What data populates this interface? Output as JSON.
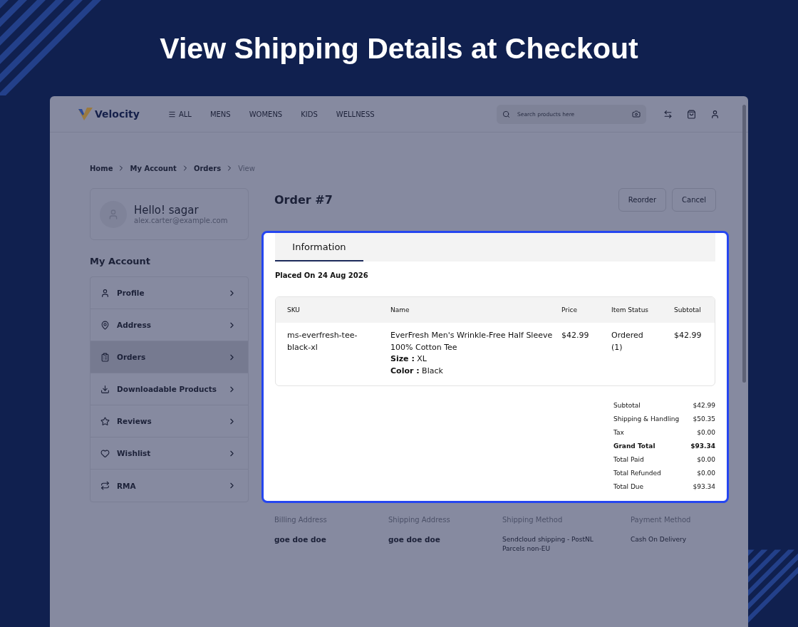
{
  "headline": "View Shipping Details at Checkout",
  "header": {
    "logo": "Velocity",
    "nav": [
      {
        "label": "ALL",
        "kind": "menu"
      },
      {
        "label": "MENS",
        "kind": "link"
      },
      {
        "label": "WOMENS",
        "kind": "link"
      },
      {
        "label": "KIDS",
        "kind": "link"
      },
      {
        "label": "WELLNESS",
        "kind": "link"
      }
    ],
    "search": {
      "placeholder": "Search products here"
    }
  },
  "breadcrumb": [
    {
      "label": "Home",
      "current": false
    },
    {
      "label": "My Account",
      "current": false
    },
    {
      "label": "Orders",
      "current": false
    },
    {
      "label": "View",
      "current": true
    }
  ],
  "profile": {
    "greeting": "Hello! sagar",
    "email": "alex.carter@example.com"
  },
  "sidebar": {
    "title": "My Account",
    "items": [
      {
        "label": "Profile",
        "selected": false
      },
      {
        "label": "Address",
        "selected": false
      },
      {
        "label": "Orders",
        "selected": true
      },
      {
        "label": "Downloadable Products",
        "selected": false
      },
      {
        "label": "Reviews",
        "selected": false
      },
      {
        "label": "Wishlist",
        "selected": false
      },
      {
        "label": "RMA",
        "selected": false
      }
    ]
  },
  "order": {
    "title": "Order #7",
    "buttons": [
      "Reorder",
      "Cancel"
    ],
    "tabs": [
      {
        "label": "Information",
        "selected": true
      }
    ],
    "placed": "Placed On 24 Aug 2026",
    "table": {
      "columns": [
        "SKU",
        "Name",
        "Price",
        "Item Status",
        "Subtotal"
      ],
      "rows": [
        {
          "sku": "ms-everfresh-tee-black-xl",
          "name": "EverFresh Men's Wrinkle-Free Half Sleeve 100% Cotton Tee",
          "options": [
            "**Size :** XL",
            "**Color :** Black"
          ],
          "price": "$42.99",
          "status": "Ordered (1)",
          "subtotal": "$42.99"
        }
      ]
    },
    "totals": [
      {
        "label": "Subtotal",
        "value": "$42.99",
        "bold": false
      },
      {
        "label": "Shipping & Handling",
        "value": "$50.35",
        "bold": false
      },
      {
        "label": "Tax",
        "value": "$0.00",
        "bold": false
      },
      {
        "label": "Grand Total",
        "value": "$93.34",
        "bold": true
      },
      {
        "label": "Total Paid",
        "value": "$0.00",
        "bold": false
      },
      {
        "label": "Total Refunded",
        "value": "$0.00",
        "bold": false
      },
      {
        "label": "Total Due",
        "value": "$93.34",
        "bold": false
      }
    ],
    "details": [
      {
        "label": "Billing Address",
        "value": "goe doe doe",
        "kind": "name"
      },
      {
        "label": "Shipping Address",
        "value": "goe doe doe",
        "kind": "name"
      },
      {
        "label": "Shipping Method",
        "value": "Sendcloud shipping - PostNL Parcels non-EU",
        "kind": "text"
      },
      {
        "label": "Payment Method",
        "value": "Cash On Delivery",
        "kind": "text"
      }
    ]
  }
}
